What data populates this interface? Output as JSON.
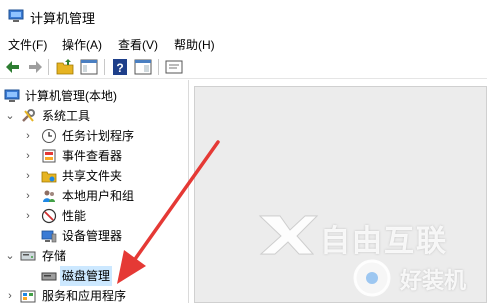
{
  "window": {
    "title": "计算机管理"
  },
  "menu": [
    "文件(F)",
    "操作(A)",
    "查看(V)",
    "帮助(H)"
  ],
  "toolbar": {
    "buttons": [
      "back-icon",
      "forward-icon",
      "folder-up-icon",
      "show-hide-tree-icon",
      "help-icon",
      "properties-icon",
      "console-icon"
    ]
  },
  "tree": {
    "root": "计算机管理(本地)",
    "system_tools": "系统工具",
    "task_scheduler": "任务计划程序",
    "event_viewer": "事件查看器",
    "shared_folders": "共享文件夹",
    "local_users": "本地用户和组",
    "performance": "性能",
    "device_manager": "设备管理器",
    "storage": "存储",
    "disk_management": "磁盘管理",
    "services_apps": "服务和应用程序"
  },
  "watermark": {
    "brand": "自由互联",
    "secondary": "好装机"
  },
  "colors": {
    "selection": "#cce8ff",
    "arrow": "#e53935",
    "content_bg": "#ececec"
  }
}
